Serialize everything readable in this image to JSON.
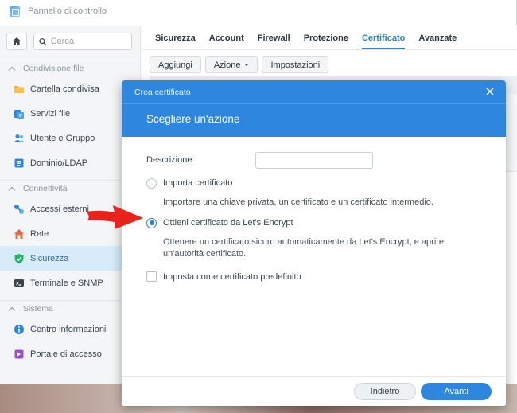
{
  "window": {
    "title": "Pannello di controllo"
  },
  "sidebar": {
    "search_placeholder": "Cerca",
    "sections": [
      {
        "label": "Condivisione file",
        "items": [
          {
            "label": "Cartella condivisa",
            "icon": "folder-icon"
          },
          {
            "label": "Servizi file",
            "icon": "file-services-icon"
          },
          {
            "label": "Utente e Gruppo",
            "icon": "users-icon"
          },
          {
            "label": "Dominio/LDAP",
            "icon": "directory-icon"
          }
        ]
      },
      {
        "label": "Connettività",
        "items": [
          {
            "label": "Accessi esterni",
            "icon": "external-access-icon"
          },
          {
            "label": "Rete",
            "icon": "network-icon"
          },
          {
            "label": "Sicurezza",
            "icon": "shield-icon",
            "active": true
          },
          {
            "label": "Terminale e SNMP",
            "icon": "terminal-icon"
          }
        ]
      },
      {
        "label": "Sistema",
        "items": [
          {
            "label": "Centro informazioni",
            "icon": "info-icon"
          },
          {
            "label": "Portale di accesso",
            "icon": "login-portal-icon"
          }
        ]
      }
    ]
  },
  "tabs": [
    "Sicurezza",
    "Account",
    "Firewall",
    "Protezione",
    "Certificato",
    "Avanzate"
  ],
  "active_tab": "Certificato",
  "toolbar": {
    "add": "Aggiungi",
    "action": "Azione",
    "settings": "Impostazioni"
  },
  "dialog": {
    "window_title": "Crea certificato",
    "heading": "Scegliere un'azione",
    "description_label": "Descrizione:",
    "description_value": "",
    "options": [
      {
        "label": "Importa certificato",
        "help": "Importare una chiave privata, un certificato e un certificato intermedio.",
        "checked": false
      },
      {
        "label": "Ottieni certificato da Let's Encrypt",
        "help": "Ottenere un certificato sicuro automaticamente da Let's Encrypt, e aprire un'autorità certificato.",
        "checked": true
      }
    ],
    "default_checkbox": {
      "label": "Imposta come certificato predefinito",
      "checked": false
    },
    "back_button": "Indietro",
    "next_button": "Avanti"
  },
  "colors": {
    "accent": "#2f86de",
    "arrow": "#e8231c"
  }
}
